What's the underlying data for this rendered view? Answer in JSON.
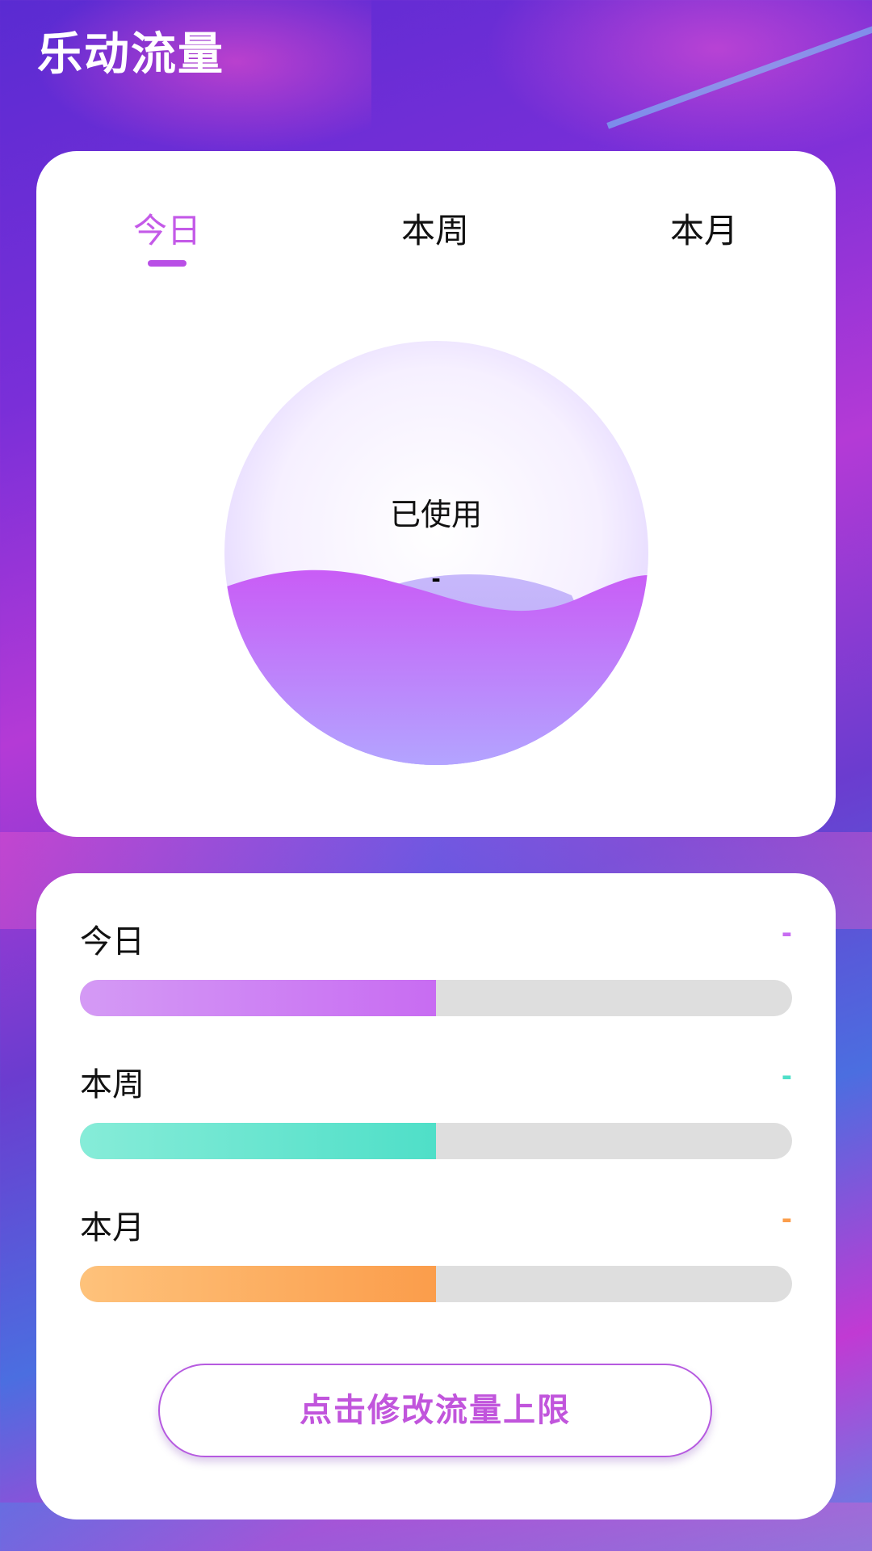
{
  "app": {
    "title": "乐动流量"
  },
  "tabs": [
    {
      "label": "今日",
      "active": true
    },
    {
      "label": "本周",
      "active": false
    },
    {
      "label": "本月",
      "active": false
    }
  ],
  "gauge": {
    "label": "已使用",
    "value": "-",
    "fill_level": 0.5
  },
  "usage_rows": [
    {
      "label": "今日",
      "value": "-",
      "progress": 0.5,
      "color": "#c86cf2"
    },
    {
      "label": "本周",
      "value": "-",
      "progress": 0.5,
      "color": "#4fdfc8"
    },
    {
      "label": "本月",
      "value": "-",
      "progress": 0.5,
      "color": "#fb9d4b"
    }
  ],
  "edit_button": {
    "label": "点击修改流量上限"
  }
}
